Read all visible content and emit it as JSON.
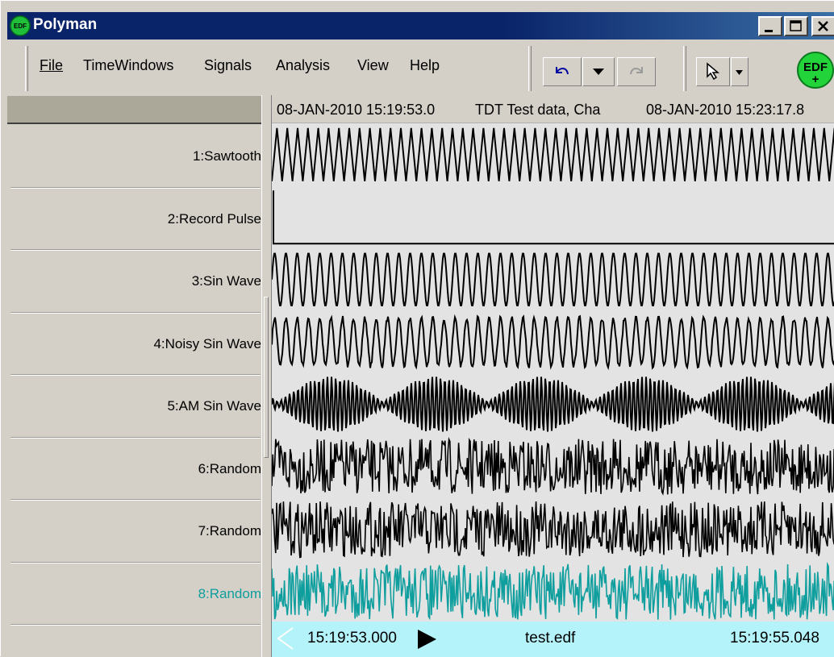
{
  "window": {
    "title": "Polyman",
    "icon": "edf-app-icon"
  },
  "menu": {
    "file": "File",
    "timewindows": "TimeWindows",
    "signals": "Signals",
    "analysis": "Analysis",
    "view": "View",
    "help": "Help"
  },
  "toolbar": {
    "undo": "undo-icon",
    "dropdown": "chevron-down-icon",
    "redo": "redo-icon",
    "pointer": "pointer-cursor-icon",
    "logo_text": "EDF",
    "logo_plus": "+"
  },
  "header": {
    "start": "08-JAN-2010 15:19:53.0",
    "info": "TDT Test data, Cha",
    "end": "08-JAN-2010 15:23:17.8"
  },
  "channels": [
    {
      "label": "1:Sawtooth",
      "type": "sawtooth",
      "color": "#000000"
    },
    {
      "label": "2:Record Pulse",
      "type": "pulse",
      "color": "#000000"
    },
    {
      "label": "3:Sin Wave",
      "type": "sine",
      "color": "#000000"
    },
    {
      "label": "4:Noisy Sin Wave",
      "type": "noisy-sine",
      "color": "#000000"
    },
    {
      "label": "5:AM Sin Wave",
      "type": "am-sine",
      "color": "#000000"
    },
    {
      "label": "6:Random",
      "type": "random",
      "color": "#000000"
    },
    {
      "label": "7:Random",
      "type": "random",
      "color": "#000000"
    },
    {
      "label": "8:Random",
      "type": "random",
      "color": "#0e9e9e"
    }
  ],
  "status": {
    "start_time": "15:19:53.000",
    "filename": "test.edf",
    "end_time": "15:19:55.048",
    "background": "#b4f3fa"
  }
}
